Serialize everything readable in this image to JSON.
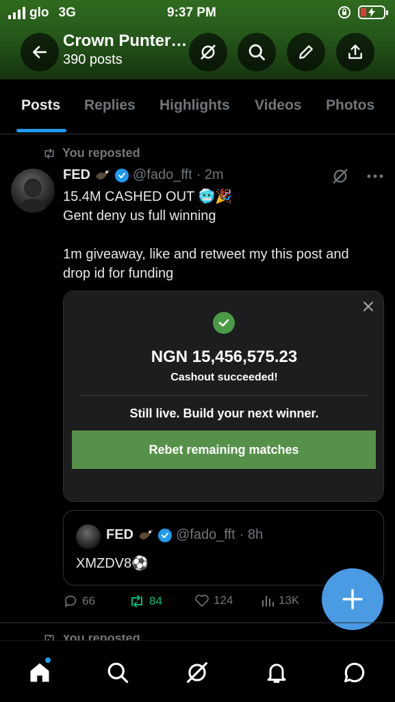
{
  "status_bar": {
    "carrier": "glo",
    "network": "3G",
    "time": "9:37 PM"
  },
  "header": {
    "title": "Crown Punter…",
    "posts_count": "390 posts"
  },
  "tabs": [
    {
      "label": "Posts",
      "active": true
    },
    {
      "label": "Replies",
      "active": false
    },
    {
      "label": "Highlights",
      "active": false
    },
    {
      "label": "Videos",
      "active": false
    },
    {
      "label": "Photos",
      "active": false
    }
  ],
  "post": {
    "repost_label": "You reposted",
    "author_name": "FED",
    "handle": "@fado_fft",
    "time": "· 2m",
    "text_lines": [
      "15.4M CASHED OUT 🥶🎉",
      "Gent deny us full winning",
      "",
      "1m giveaway, like and retweet my this post and",
      "drop id for funding"
    ],
    "card": {
      "amount": "NGN 15,456,575.23",
      "subtitle": "Cashout succeeded!",
      "message": "Still live. Build your next winner.",
      "button_label": "Rebet remaining matches"
    },
    "quote": {
      "author_name": "FED",
      "handle": "@fado_fft",
      "time": "· 8h",
      "text": "XMZDV8⚽"
    },
    "stats": {
      "replies": "66",
      "reposts": "84",
      "likes": "124",
      "views": "13K"
    }
  },
  "next_post": {
    "repost_label": "You reposted"
  },
  "colors": {
    "accent": "#1d9bf0",
    "repost_green": "#00ba7c",
    "rebet_green": "#56914a",
    "fab": "#4a9ae4"
  }
}
